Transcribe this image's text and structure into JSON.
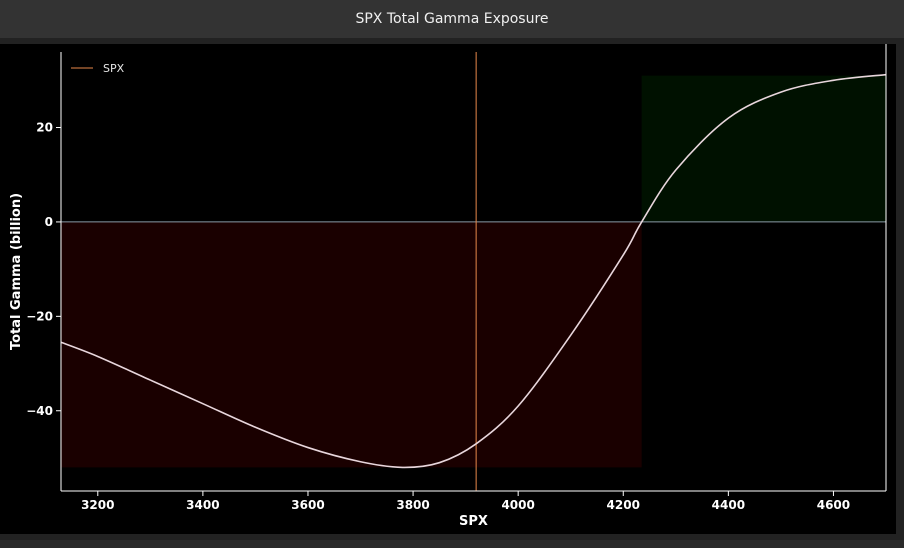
{
  "window": {
    "title": "SPX Total Gamma Exposure"
  },
  "chart_data": {
    "type": "line",
    "title": "SPX Total Gamma Exposure",
    "xlabel": "SPX",
    "ylabel": "Total Gamma (billion)",
    "xlim": [
      3130,
      4700
    ],
    "ylim": [
      -57,
      36
    ],
    "xticks": [
      3200,
      3400,
      3600,
      3800,
      4000,
      4200,
      4400,
      4600
    ],
    "yticks": [
      -40,
      -20,
      0,
      20
    ],
    "grid": false,
    "legend": {
      "placement": "top-left",
      "entries": [
        "SPX"
      ]
    },
    "spot_line": {
      "name": "SPX",
      "x": 3920
    },
    "zero_gamma_level": 4235,
    "shaded_regions": [
      {
        "from": 3130,
        "to": 4235,
        "y_to": -52,
        "kind": "negative"
      },
      {
        "from": 4235,
        "to": 4700,
        "y_to": 31,
        "kind": "positive"
      }
    ],
    "series": [
      {
        "x": [
          3130,
          3200,
          3300,
          3400,
          3500,
          3600,
          3700,
          3780,
          3850,
          3920,
          4000,
          4100,
          4200,
          4235,
          4300,
          4400,
          4500,
          4600,
          4700
        ],
        "values": [
          -25.5,
          -28.5,
          -33.5,
          -38.5,
          -43.5,
          -47.8,
          -50.8,
          -52,
          -51,
          -47,
          -39,
          -24,
          -7,
          0,
          11,
          22,
          27.5,
          30,
          31.2
        ]
      }
    ],
    "colors": {
      "curve": "#e8d6dc",
      "spot_line": "#e8884a",
      "negative_fill": "#1a0000",
      "positive_fill": "#001100",
      "zero_line": "#8a9aa6"
    }
  }
}
